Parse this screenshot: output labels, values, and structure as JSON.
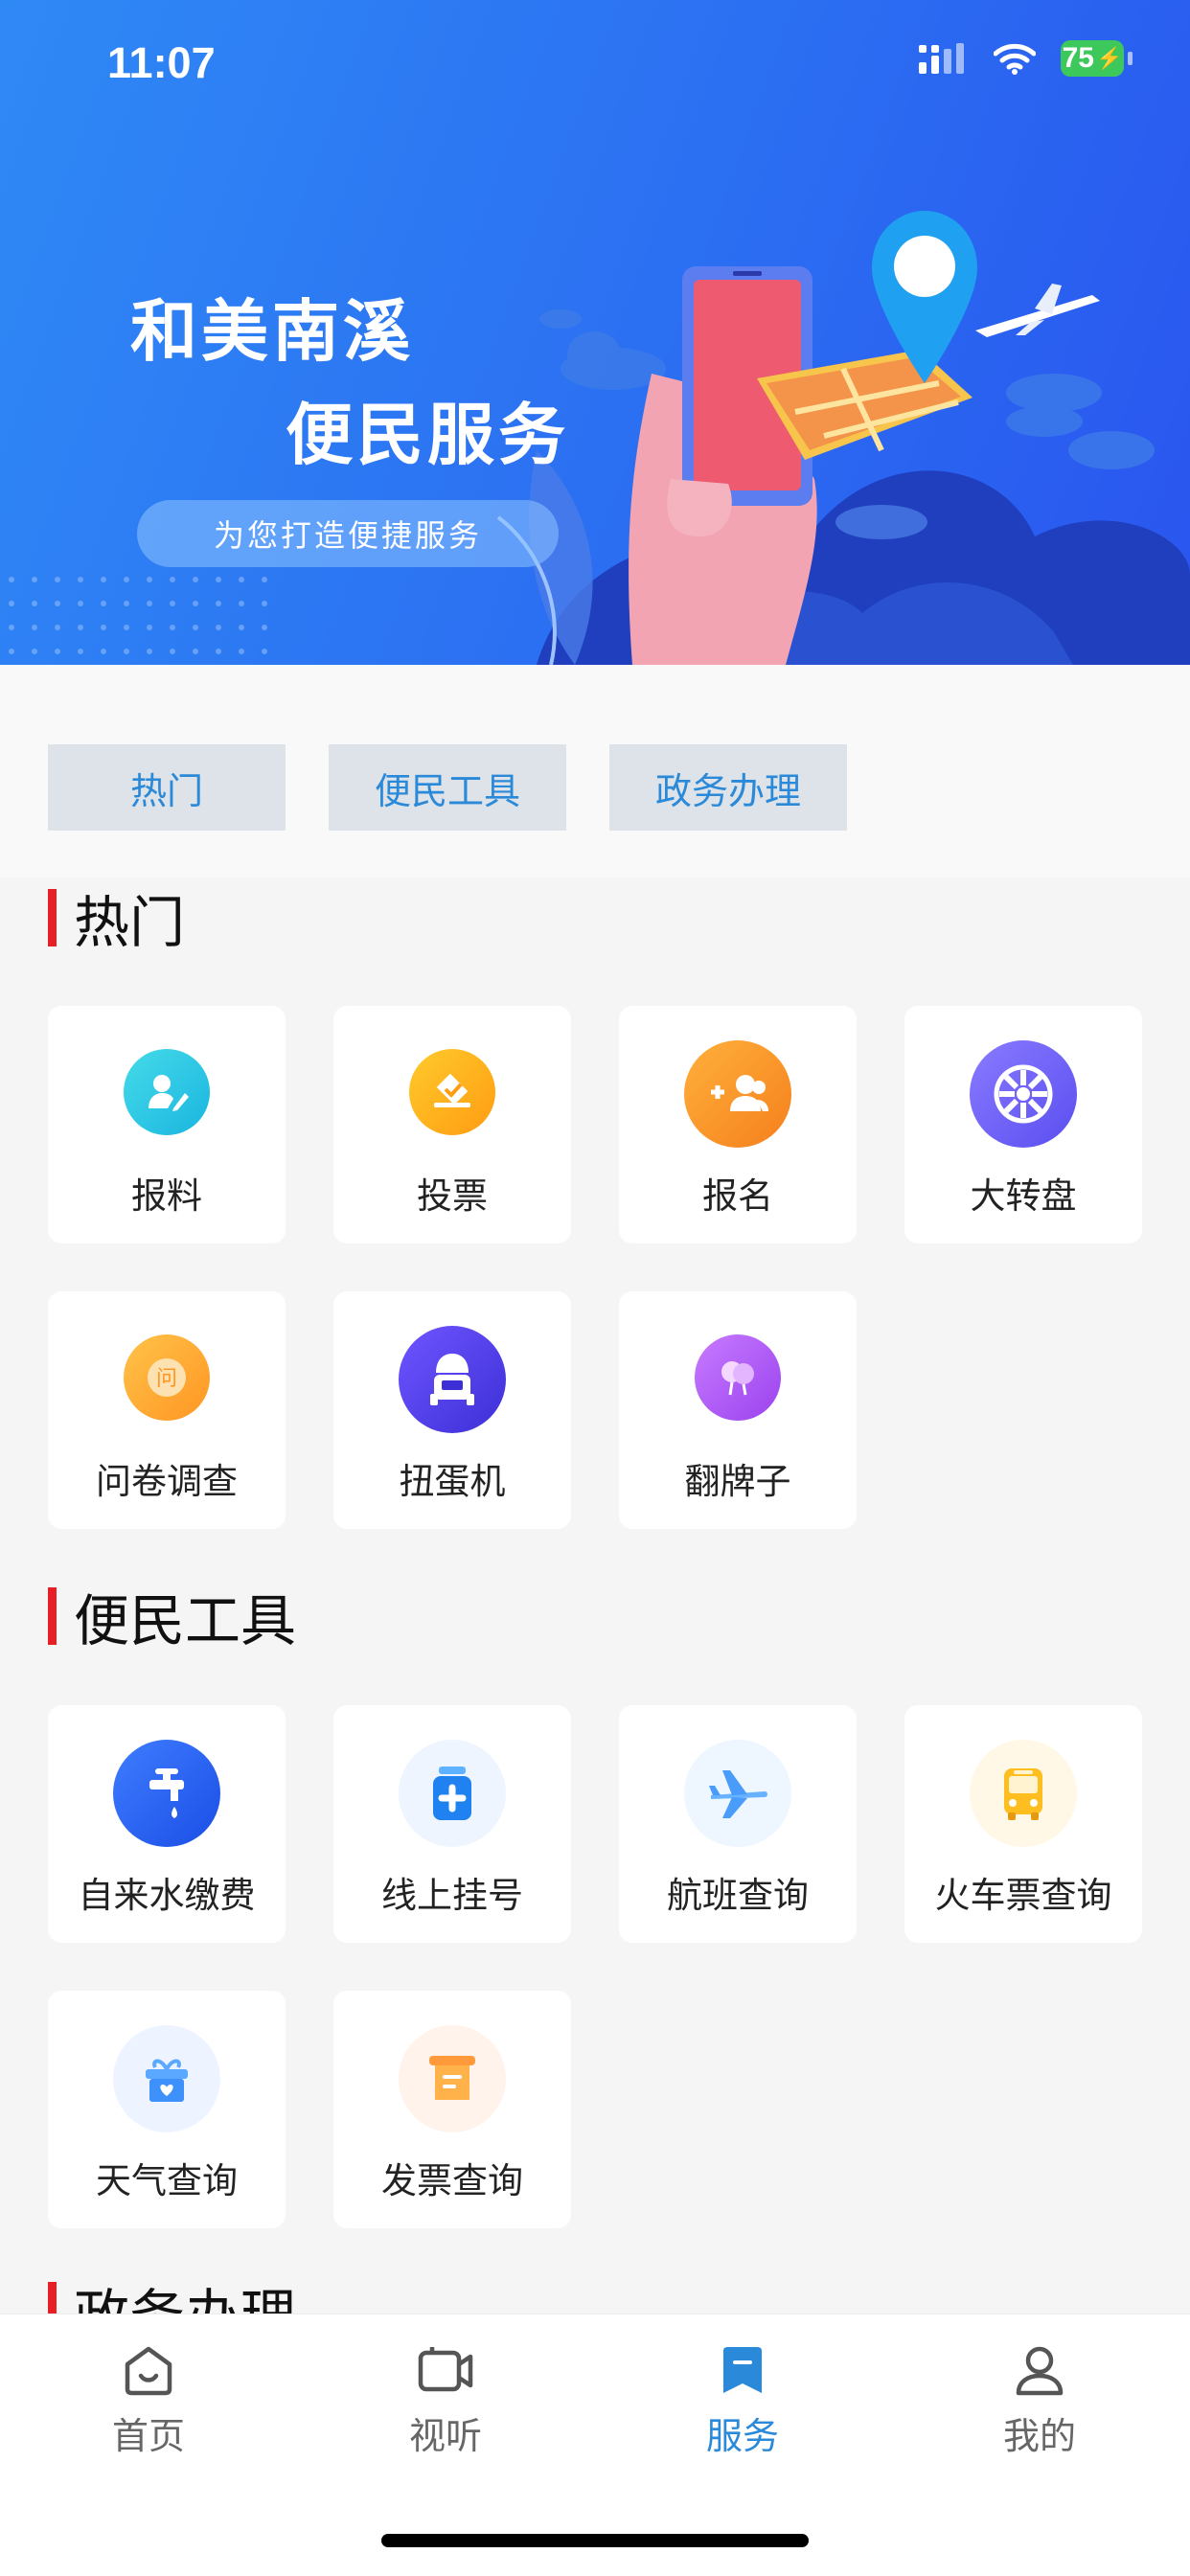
{
  "status_bar": {
    "time": "11:07",
    "battery": "75"
  },
  "banner": {
    "title_line1": "和美南溪",
    "title_line2": "便民服务",
    "subtitle": "为您打造便捷服务"
  },
  "tabs": [
    {
      "label": "热门"
    },
    {
      "label": "便民工具"
    },
    {
      "label": "政务办理"
    }
  ],
  "sections": {
    "hot": {
      "title": "热门",
      "items": [
        {
          "label": "报料",
          "icon": "report-icon"
        },
        {
          "label": "投票",
          "icon": "vote-icon"
        },
        {
          "label": "报名",
          "icon": "signup-icon"
        },
        {
          "label": "大转盘",
          "icon": "wheel-icon"
        },
        {
          "label": "问卷调查",
          "icon": "survey-icon"
        },
        {
          "label": "扭蛋机",
          "icon": "gacha-icon"
        },
        {
          "label": "翻牌子",
          "icon": "flip-card-icon"
        }
      ]
    },
    "tools": {
      "title": "便民工具",
      "items": [
        {
          "label": "自来水缴费",
          "icon": "water-tap-icon"
        },
        {
          "label": "线上挂号",
          "icon": "medical-icon"
        },
        {
          "label": "航班查询",
          "icon": "airplane-icon"
        },
        {
          "label": "火车票查询",
          "icon": "bus-icon"
        },
        {
          "label": "天气查询",
          "icon": "gift-heart-icon"
        },
        {
          "label": "发票查询",
          "icon": "invoice-icon"
        }
      ]
    },
    "gov": {
      "title": "政务办理"
    }
  },
  "bottom_nav": [
    {
      "label": "首页",
      "icon": "home-icon"
    },
    {
      "label": "视听",
      "icon": "video-icon"
    },
    {
      "label": "服务",
      "icon": "bookmark-icon",
      "active": true
    },
    {
      "label": "我的",
      "icon": "user-icon"
    }
  ],
  "colors": {
    "accent": "#2a89d8",
    "section_bar": "#e81e25",
    "banner": "#2b6ff2"
  }
}
